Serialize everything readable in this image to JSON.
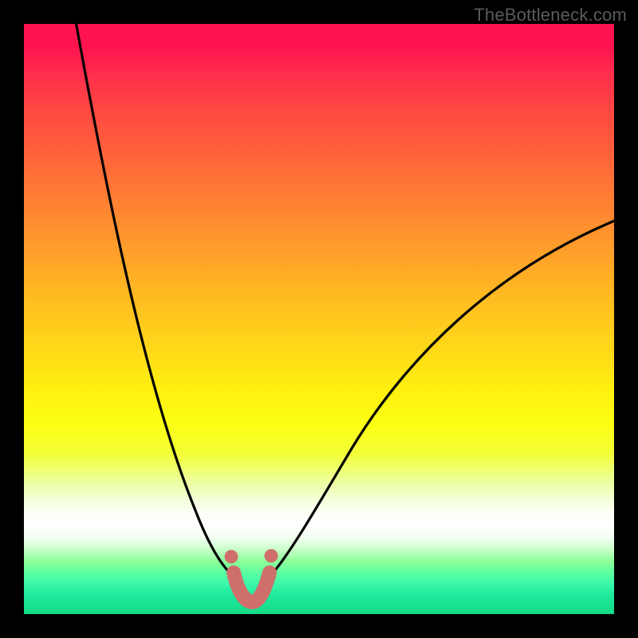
{
  "watermark": {
    "text": "TheBottleneck.com"
  },
  "colors": {
    "background": "#000000",
    "curve": "#000000",
    "marker": "#cf6f6b",
    "gradient_top": "#ff1450",
    "gradient_mid": "#fff010",
    "gradient_bottom": "#15dc88"
  },
  "chart_data": {
    "type": "line",
    "title": "",
    "xlabel": "",
    "ylabel": "",
    "xlim": [
      0,
      100
    ],
    "ylim": [
      0,
      100
    ],
    "annotations": [],
    "series": [
      {
        "name": "bottleneck-curve-left",
        "x": [
          8,
          10,
          12,
          14,
          16,
          18,
          20,
          22,
          24,
          26,
          28,
          30,
          32,
          33
        ],
        "values": [
          100,
          90,
          80,
          70,
          60,
          51,
          43,
          35,
          28,
          22,
          16,
          11,
          6,
          3
        ]
      },
      {
        "name": "bottleneck-curve-right",
        "x": [
          40,
          42,
          44,
          48,
          52,
          56,
          60,
          66,
          72,
          78,
          84,
          90,
          96,
          100
        ],
        "values": [
          3,
          6,
          10,
          17,
          24,
          30,
          35,
          42,
          48,
          53,
          57,
          61,
          64,
          66
        ]
      },
      {
        "name": "optimal-band",
        "x": [
          33,
          34,
          35,
          36,
          37,
          38,
          39,
          40
        ],
        "values": [
          3,
          1,
          0,
          0,
          0,
          0,
          1,
          3
        ]
      }
    ],
    "markers": {
      "end_dots": [
        {
          "x": 33,
          "y": 12
        },
        {
          "x": 40,
          "y": 12
        }
      ],
      "band_stroke_width_px": 18
    }
  }
}
